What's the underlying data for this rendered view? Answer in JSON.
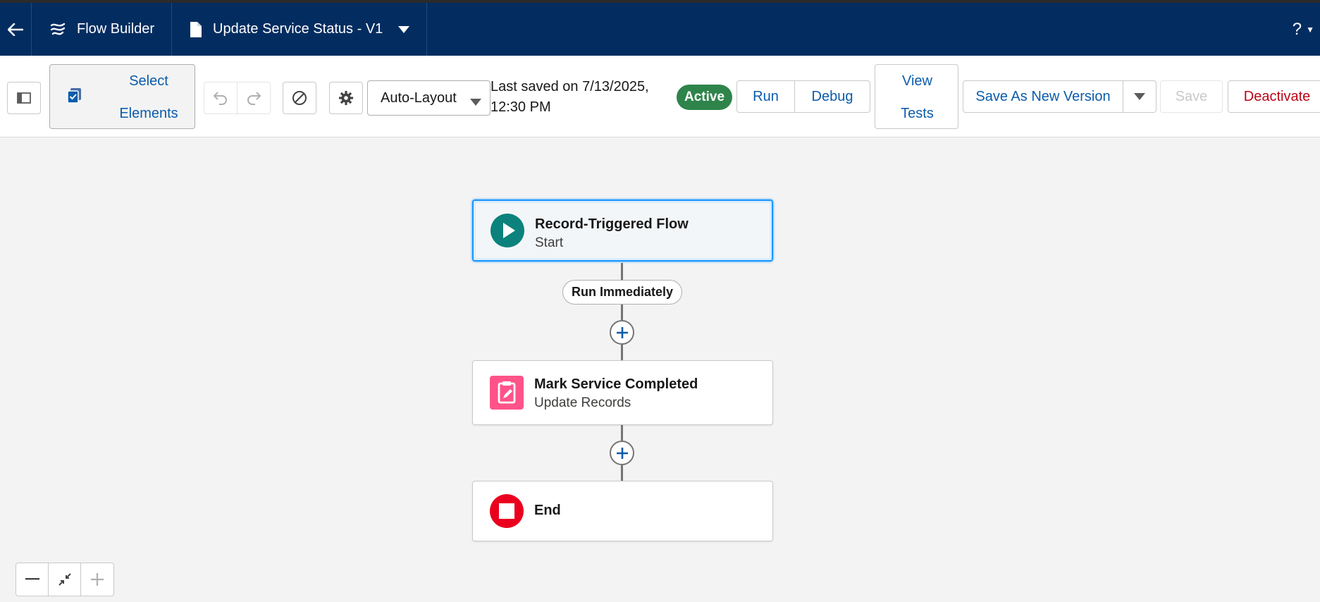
{
  "header": {
    "back_icon": "arrow-left-icon",
    "app_name": "Flow Builder",
    "flow_name": "Update Service Status - V1",
    "help_label": "?"
  },
  "toolbar": {
    "select_elements_line1": "Select",
    "select_elements_line2": "Elements",
    "layout_value": "Auto-Layout",
    "last_saved_line1": "Last saved on 7/13/2025,",
    "last_saved_line2": "12:30 PM",
    "status_badge": "Active",
    "run_label": "Run",
    "debug_label": "Debug",
    "view_tests_line1": "View",
    "view_tests_line2": "Tests",
    "save_as_new_label": "Save As New Version",
    "save_label": "Save",
    "deactivate_label": "Deactivate"
  },
  "canvas": {
    "start_node": {
      "title": "Record-Triggered Flow",
      "subtitle": "Start"
    },
    "path_label": "Run Immediately",
    "update_node": {
      "title": "Mark Service Completed",
      "subtitle": "Update Records"
    },
    "end_node": {
      "title": "End"
    }
  },
  "colors": {
    "header_bg": "#032d60",
    "active_badge": "#2e844a",
    "start_icon": "#0b827c",
    "update_icon": "#ff538a",
    "end_icon": "#ea001e",
    "link": "#0b5cab",
    "deactivate": "#ba0517"
  }
}
